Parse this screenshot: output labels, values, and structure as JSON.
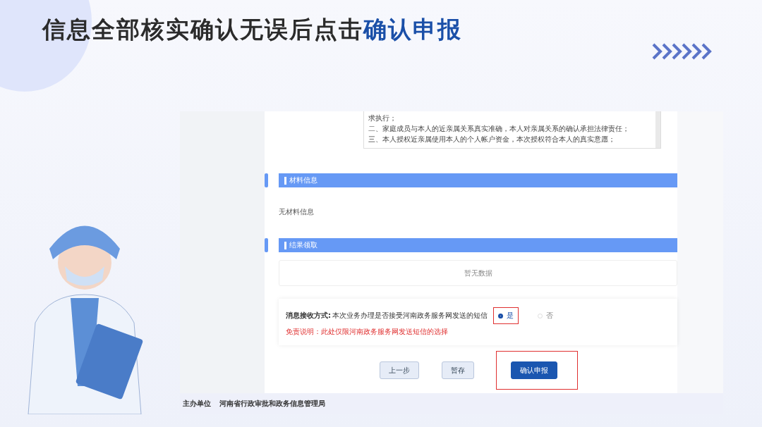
{
  "slide_title": {
    "text": "信息全部核实确认无误后点击",
    "highlight": "确认申报"
  },
  "screenshot": {
    "agreement_lines": [
      "求执行；",
      "二、家庭成员与本人的近亲属关系真实准确，本人对亲属关系的确认承担法律责任；",
      "三、本人授权近亲属使用本人的个人帐户资金，本次授权符合本人的真实意愿；"
    ],
    "sections": [
      {
        "title": "材料信息",
        "kind": "text",
        "content": "无材料信息"
      },
      {
        "title": "结果领取",
        "kind": "empty",
        "content": "暂无数据"
      }
    ],
    "message": {
      "label": "消息接收方式:",
      "question": "本次业务办理是否接受河南政务服务网发送的短信",
      "note": "免责说明：此处仅限河南政务服务网发送短信的选择",
      "options": [
        {
          "label": "是",
          "selected": true,
          "highlighted": true
        },
        {
          "label": "否",
          "selected": false,
          "highlighted": false
        }
      ]
    },
    "buttons": [
      {
        "label": "上一步",
        "kind": "secondary",
        "highlighted": false
      },
      {
        "label": "暂存",
        "kind": "secondary",
        "highlighted": false
      },
      {
        "label": "确认申报",
        "kind": "primary",
        "highlighted": true
      }
    ],
    "footer": {
      "label": "主办单位",
      "organizer": "河南省行政审批和政务信息管理局"
    }
  }
}
